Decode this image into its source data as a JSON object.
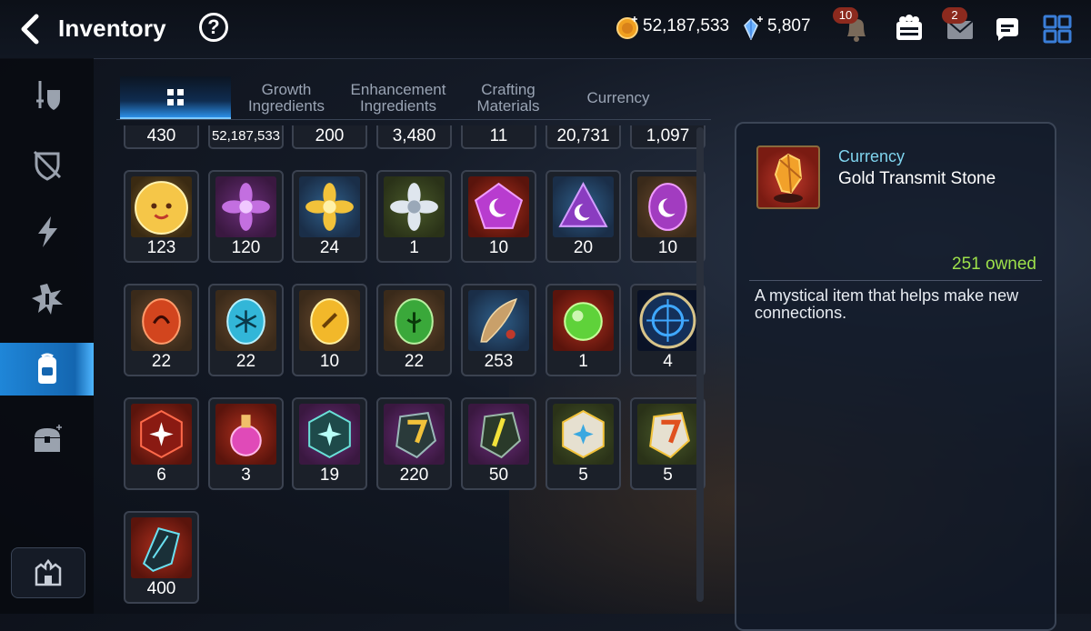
{
  "header": {
    "title": "Inventory",
    "help_label": "?",
    "gold": "52,187,533",
    "crystals": "5,807",
    "bell_badge": "10",
    "mail_badge": "2"
  },
  "tabs": [
    {
      "label": "",
      "icon": "grid-icon",
      "active": true
    },
    {
      "label": "Growth Ingredients"
    },
    {
      "label": "Enhancement Ingredients"
    },
    {
      "label": "Crafting Materials"
    },
    {
      "label": "Currency"
    }
  ],
  "top_counts": [
    "430",
    "52,187,533",
    "200",
    "3,480",
    "11",
    "20,731",
    "1,097"
  ],
  "items": [
    {
      "qty": "123",
      "icon": "phantasma-face-icon"
    },
    {
      "qty": "120",
      "icon": "purple-flower-icon"
    },
    {
      "qty": "24",
      "icon": "gold-flower-icon"
    },
    {
      "qty": "1",
      "icon": "silver-flower-icon"
    },
    {
      "qty": "10",
      "icon": "pentagon-moon-gem-icon"
    },
    {
      "qty": "20",
      "icon": "triangle-moon-gem-icon"
    },
    {
      "qty": "10",
      "icon": "oval-moon-gem-icon"
    },
    {
      "qty": "22",
      "icon": "fire-rune-icon"
    },
    {
      "qty": "22",
      "icon": "ice-rune-icon"
    },
    {
      "qty": "10",
      "icon": "light-rune-icon"
    },
    {
      "qty": "22",
      "icon": "earth-rune-icon"
    },
    {
      "qty": "253",
      "icon": "feather-charm-icon"
    },
    {
      "qty": "1",
      "icon": "green-orb-icon"
    },
    {
      "qty": "4",
      "icon": "blue-medallion-icon"
    },
    {
      "qty": "6",
      "icon": "red-star-gem-icon"
    },
    {
      "qty": "3",
      "icon": "pink-potion-icon"
    },
    {
      "qty": "19",
      "icon": "teal-star-gem-icon"
    },
    {
      "qty": "220",
      "icon": "gold-transmit-stone-icon"
    },
    {
      "qty": "50",
      "icon": "gold-shard-stone-icon"
    },
    {
      "qty": "5",
      "icon": "silver-star-stone-icon"
    },
    {
      "qty": "5",
      "icon": "red-transmit-stone-icon"
    },
    {
      "qty": "400",
      "icon": "dark-shard-icon"
    }
  ],
  "detail": {
    "category": "Currency",
    "name": "Gold Transmit Stone",
    "owned": "251 owned",
    "description": "A mystical item that helps make new connections."
  },
  "colors": {
    "accent": "#2b8ee6",
    "owned": "#9de04a",
    "category": "#7fd4ee"
  }
}
